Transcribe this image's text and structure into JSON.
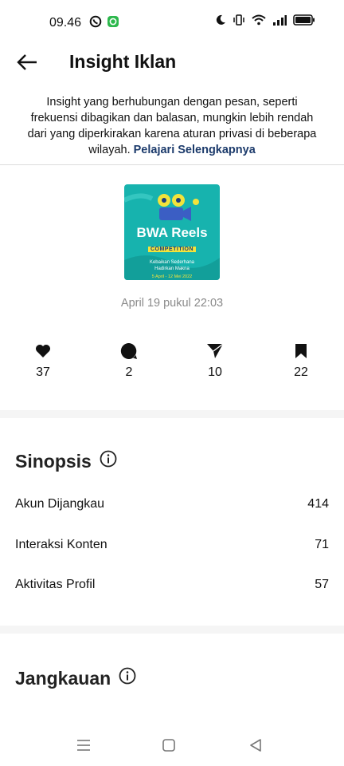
{
  "status_bar": {
    "time": "09.46",
    "left_icons": [
      "whatsapp-icon",
      "line-app-icon"
    ],
    "right_icons": [
      "moon-icon",
      "vibrate-icon",
      "wifi-icon",
      "signal-icon",
      "battery-icon"
    ]
  },
  "header": {
    "title": "Insight Iklan",
    "back_icon": "back-arrow-icon"
  },
  "notice": {
    "text": "Insight yang berhubungan dengan pesan, seperti frekuensi dibagikan dan balasan, mungkin lebih rendah dari yang diperkirakan karena aturan privasi di beberapa wilayah.",
    "link": "Pelajari Selengkapnya"
  },
  "post": {
    "thumbnail": {
      "title_line1": "BWA Reels",
      "title_line2": "COMPETITION",
      "subtitle_line1": "Kebaikan Sederhana",
      "subtitle_line2": "Hadirkan Makna",
      "dates": "5 April - 12 Mei 2022",
      "bg_color": "#17b3ae",
      "accent_color": "#f2e33b"
    },
    "date": "April 19 pukul 22:03"
  },
  "stats": [
    {
      "icon": "heart-icon",
      "value": "37"
    },
    {
      "icon": "comment-icon",
      "value": "2"
    },
    {
      "icon": "share-icon",
      "value": "10"
    },
    {
      "icon": "bookmark-icon",
      "value": "22"
    }
  ],
  "sinopsis": {
    "title": "Sinopsis",
    "info_icon": "info-icon",
    "rows": [
      {
        "label": "Akun Dijangkau",
        "value": "414"
      },
      {
        "label": "Interaksi Konten",
        "value": "71"
      },
      {
        "label": "Aktivitas Profil",
        "value": "57"
      }
    ]
  },
  "jangkauan": {
    "title": "Jangkauan",
    "info_icon": "info-icon"
  },
  "nav_bar": {
    "buttons": [
      "menu-icon",
      "home-square-icon",
      "back-triangle-icon"
    ]
  }
}
